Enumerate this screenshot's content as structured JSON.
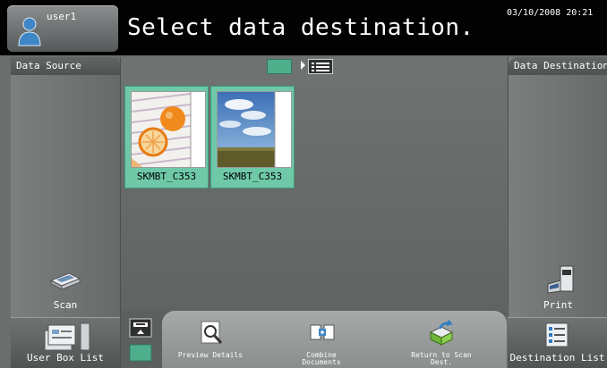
{
  "header": {
    "user": "user1",
    "message": "Select data destination.",
    "datetime": "03/10/2008 20:21"
  },
  "left_panel": {
    "title": "Data Source",
    "scan_label": "Scan",
    "bottom_label": "User Box List"
  },
  "right_panel": {
    "title": "Data Destination",
    "print_label": "Print",
    "bottom_label": "Destination List"
  },
  "files": [
    {
      "name": "SKMBT_C353",
      "thumbnail": "orange-photo"
    },
    {
      "name": "SKMBT_C353",
      "thumbnail": "sky-field-photo"
    }
  ],
  "view_modes": [
    "thumbnail-view-icon",
    "list-view-icon"
  ],
  "bottom_functions": {
    "preview_label": "Preview Details",
    "combine_label": "Combine Documents",
    "return_label": "Return to Scan Dest."
  },
  "colors": {
    "selected_file": "#6fc9a8",
    "top_bar": "#020202",
    "panel": "#6a6e6d"
  }
}
